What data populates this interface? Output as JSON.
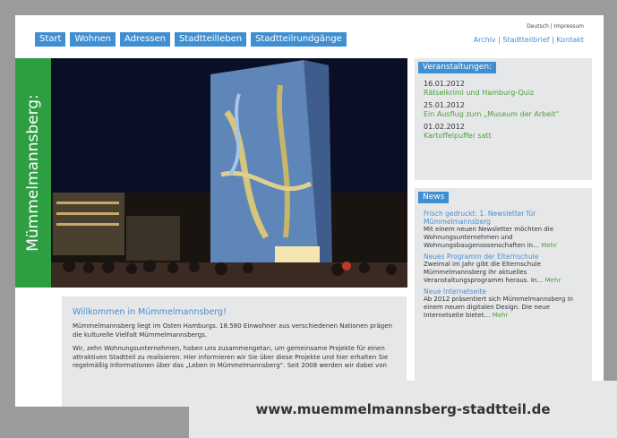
{
  "nav": [
    "Start",
    "Wohnen",
    "Adressen",
    "Stadtteilleben",
    "Stadtteilrundgänge"
  ],
  "lang_line": "Deutsch | Impressum",
  "top_links": "Archiv | Stadtteilbrief | Kontakt",
  "hero_title": "Mümmelmannsberg:",
  "events": {
    "heading": "Veranstaltungen:",
    "items": [
      {
        "date": "16.01.2012",
        "title": "Rätselkrimi und Hamburg-Quiz"
      },
      {
        "date": "25.01.2012",
        "title": "Ein Ausflug zum „Museum der Arbeit“"
      },
      {
        "date": "01.02.2012",
        "title": "Kartoffelpuffer satt"
      }
    ]
  },
  "news": {
    "heading": "News",
    "items": [
      {
        "title": "Frisch gedruckt: 1. Newsletter für Mümmelmannsberg",
        "text": "Mit einem neuen Newsletter möchten die Wohnungsunternehmen und Wohnungsbaugenossenschaften in…",
        "more": "Mehr"
      },
      {
        "title": "Neues Programm der Elternschule",
        "text": "Zweimal im Jahr gibt die Elternschule Mümmelmannsberg ihr aktuelles Veranstaltungsprogramm heraus. In…",
        "more": "Mehr"
      },
      {
        "title": "Neue Internetseite",
        "text": "Ab 2012 präsentiert sich Mümmelmannsberg in einem neuen digitalen Design. Die neue Internetseite bietet…",
        "more": "Mehr"
      }
    ]
  },
  "welcome": {
    "title": "Willkommen in Mümmelmannsberg!",
    "p1": "Mümmelmannsberg liegt im Osten Hamburgs. 18.580 Einwohner aus verschiedenen Nationen prägen die kulturelle Vielfalt Mümmelmannsbergs.",
    "p2": "Wir, zehn Wohnungsunternehmen, haben uns zusammengetan, um gemeinsame Projekte für einen attraktiven Stadtteil zu realisieren. Hier informieren wir Sie über diese Projekte und hier erhalten Sie regelmäßig Informationen über das „Leben in Mümmelmannsberg“. Seit 2008 werden wir dabei von"
  },
  "caption": "www.muemmelmannsberg-stadtteil.de"
}
